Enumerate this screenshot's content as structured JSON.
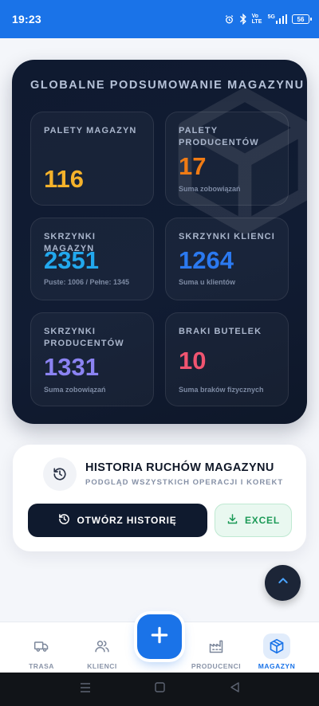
{
  "status_bar": {
    "time": "19:23",
    "icons": [
      "alarm-icon",
      "bluetooth-icon",
      "volte-icon",
      "signal-icon",
      "battery-icon"
    ],
    "volte_label": "Vo LTE",
    "network_label": "5G",
    "battery_level": "56"
  },
  "summary": {
    "title": "GLOBALNE PODSUMOWANIE MAGAZYNU",
    "stats": [
      {
        "label": "PALETY MAGAZYN",
        "value": "116",
        "note": "",
        "color": "#f5b22b"
      },
      {
        "label": "PALETY PRODUCENTÓW",
        "value": "17",
        "note": "Suma zobowiązań",
        "color": "#f07b14"
      },
      {
        "label": "SKRZYNKI MAGAZYN",
        "value": "2351",
        "note": "Puste: 1006 / Pełne: 1345",
        "color": "#22a8ee"
      },
      {
        "label": "SKRZYNKI KLIENCI",
        "value": "1264",
        "note": "Suma u klientów",
        "color": "#2b79f0"
      },
      {
        "label": "SKRZYNKI PRODUCENTÓW",
        "value": "1331",
        "note": "Suma zobowiązań",
        "color": "#8b83f2"
      },
      {
        "label": "BRAKI BUTELEK",
        "value": "10",
        "note": "Suma braków fizycznych",
        "color": "#f05470"
      }
    ]
  },
  "history": {
    "title": "HISTORIA RUCHÓW MAGAZYNU",
    "subtitle": "PODGLĄD WSZYSTKICH OPERACJI I KOREKT",
    "open_label": "OTWÓRZ HISTORIĘ",
    "excel_label": "EXCEL"
  },
  "bottom_nav": {
    "items": [
      {
        "label": "TRASA",
        "icon": "truck-icon"
      },
      {
        "label": "KLIENCI",
        "icon": "users-icon"
      },
      {
        "label": "PRODUCENCI",
        "icon": "factory-icon"
      },
      {
        "label": "MAGAZYN",
        "icon": "box-icon",
        "active": true
      }
    ],
    "add_icon": "plus-icon"
  },
  "colors": {
    "accent": "#1a73e8",
    "card_bg": "#0f1a30",
    "excel_green": "#1c9a57"
  }
}
